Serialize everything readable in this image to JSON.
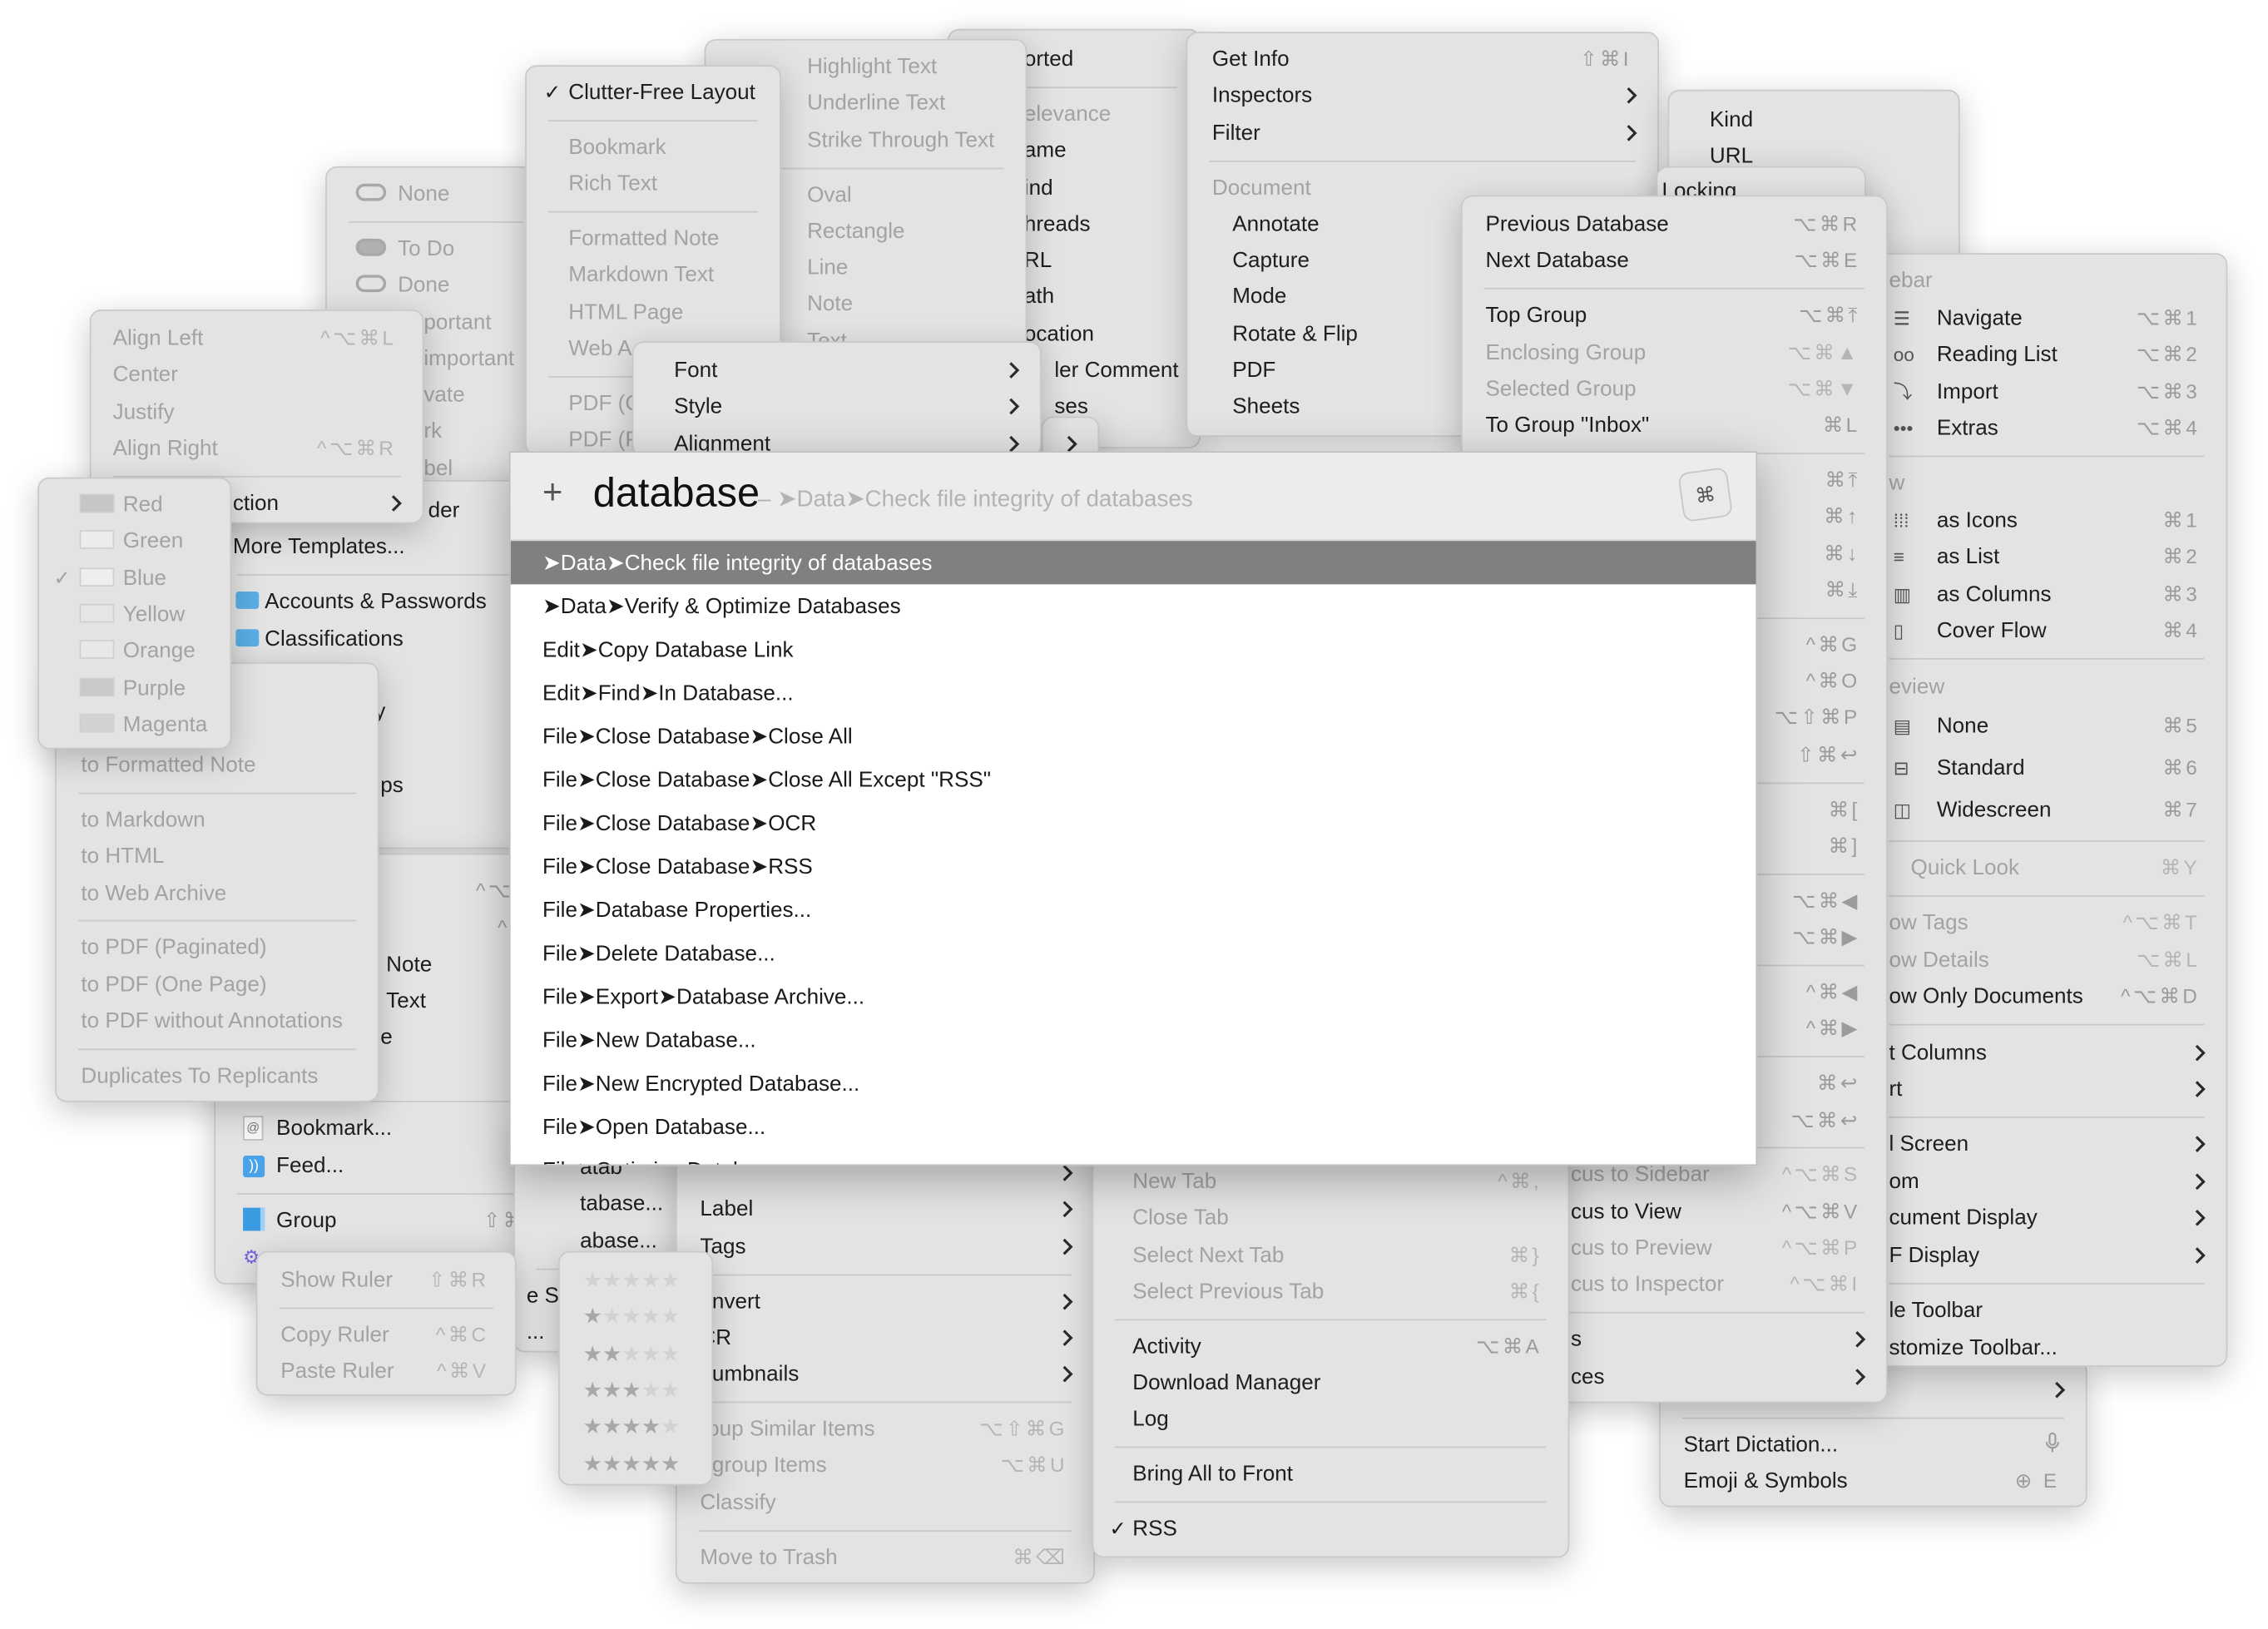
{
  "menus": [
    {
      "id": "label",
      "items": [
        {
          "label": "None",
          "icon": "pill-outline",
          "disabled": true
        },
        {
          "sep": true
        },
        {
          "label": "To Do",
          "icon": "pill-filled",
          "disabled": true
        },
        {
          "label": "Done",
          "icon": "pill-outline",
          "disabled": true
        },
        {
          "label": "portant",
          "disabled": true
        },
        {
          "label": "important",
          "disabled": true
        },
        {
          "label": "vate",
          "disabled": true
        },
        {
          "label": "rk",
          "disabled": true
        },
        {
          "label": "bel",
          "disabled": true
        }
      ]
    },
    {
      "id": "sort",
      "items": [
        {
          "label": "orted"
        },
        {
          "sep": true
        },
        {
          "label": "elevance",
          "disabled": true
        },
        {
          "label": "ame"
        },
        {
          "label": "ind"
        },
        {
          "label": "hreads"
        },
        {
          "label": "RL"
        },
        {
          "label": "ath"
        },
        {
          "label": "ocation"
        },
        {
          "label": "ler Comment"
        },
        {
          "label": "ses"
        }
      ]
    },
    {
      "id": "highlight",
      "items": [
        {
          "label": "Highlight Text",
          "disabled": true
        },
        {
          "label": "Underline Text",
          "disabled": true
        },
        {
          "label": "Strike Through Text",
          "disabled": true
        },
        {
          "sep": true
        },
        {
          "label": "Oval",
          "disabled": true
        },
        {
          "label": "Rectangle",
          "disabled": true
        },
        {
          "label": "Line",
          "disabled": true
        },
        {
          "label": "Note",
          "disabled": true
        },
        {
          "label": "Text",
          "disabled": true
        }
      ]
    },
    {
      "id": "layout",
      "items": [
        {
          "label": "Clutter-Free Layout",
          "checked": true
        },
        {
          "sep": true
        },
        {
          "label": "Bookmark",
          "disabled": true
        },
        {
          "label": "Rich Text",
          "disabled": true
        },
        {
          "sep": true
        },
        {
          "label": "Formatted Note",
          "disabled": true
        },
        {
          "label": "Markdown Text",
          "disabled": true
        },
        {
          "label": "HTML Page",
          "disabled": true
        },
        {
          "label": "Web A",
          "disabled": true
        },
        {
          "sep": true
        },
        {
          "label": "PDF (C",
          "disabled": true
        },
        {
          "label": "PDF (P",
          "disabled": true
        }
      ]
    },
    {
      "id": "templates",
      "items": [
        {
          "label": "der"
        },
        {
          "label": "More Templates..."
        },
        {
          "sep": true
        },
        {
          "label": "Accounts & Passwords",
          "icon": "folder"
        },
        {
          "label": "Classifications",
          "icon": "folder"
        },
        {
          "label": ""
        },
        {
          "label": "y"
        },
        {
          "label": ""
        },
        {
          "label": "ps"
        }
      ]
    },
    {
      "id": "submenu-stub",
      "items": [
        {
          "label": "",
          "arrow": true
        }
      ]
    },
    {
      "id": "format",
      "items": [
        {
          "label": "Font",
          "arrow": true
        },
        {
          "label": "Style",
          "arrow": true
        },
        {
          "label": "Alignment",
          "arrow": true
        }
      ]
    },
    {
      "id": "tools",
      "items": [
        {
          "label": "Get Info",
          "shortcut": "⇧⌘I"
        },
        {
          "label": "Inspectors",
          "arrow": true
        },
        {
          "label": "Filter",
          "arrow": true
        },
        {
          "sep": true
        },
        {
          "label": "Document",
          "disabled": true
        },
        {
          "label": "Annotate"
        },
        {
          "label": "Capture"
        },
        {
          "label": "Mode"
        },
        {
          "label": "Rotate & Flip"
        },
        {
          "label": "PDF"
        },
        {
          "label": "Sheets"
        }
      ]
    },
    {
      "id": "columns",
      "items": [
        {
          "label": "Kind"
        },
        {
          "label": "URL"
        }
      ]
    },
    {
      "id": "locking",
      "items": [
        {
          "label": "Locking"
        }
      ]
    },
    {
      "id": "edit",
      "items": [
        {
          "label": "",
          "arrow": true
        },
        {
          "sep": true
        },
        {
          "label": "Start Dictation...",
          "shortcut": "mic-icon"
        },
        {
          "label": "Emoji & Symbols",
          "shortcut": "⊕ E"
        }
      ]
    },
    {
      "id": "view",
      "items": [
        {
          "label": "ebar",
          "disabled": true
        },
        {
          "label": "Navigate",
          "icon": "list",
          "shortcut": "⌥⌘1"
        },
        {
          "label": "Reading List",
          "icon": "glasses",
          "shortcut": "⌥⌘2"
        },
        {
          "label": "Import",
          "icon": "import",
          "shortcut": "⌥⌘3"
        },
        {
          "label": "Extras",
          "icon": "ellipsis",
          "shortcut": "⌥⌘4"
        },
        {
          "sep": true
        },
        {
          "label": "w",
          "disabled": true
        },
        {
          "label": "as Icons",
          "icon": "grid",
          "shortcut": "⌘1"
        },
        {
          "label": "as List",
          "icon": "lines",
          "shortcut": "⌘2"
        },
        {
          "label": "as Columns",
          "icon": "columns",
          "shortcut": "⌘3"
        },
        {
          "label": "Cover Flow",
          "icon": "cover-flow",
          "shortcut": "⌘4"
        },
        {
          "sep": true
        },
        {
          "label": "eview",
          "disabled": true
        },
        {
          "label": "None",
          "icon": "preview-none",
          "shortcut": "⌘5"
        },
        {
          "label": "Standard",
          "icon": "preview-standard",
          "shortcut": "⌘6"
        },
        {
          "label": "Widescreen",
          "icon": "preview-wide",
          "shortcut": "⌘7"
        },
        {
          "sep": true
        },
        {
          "label": "Quick Look",
          "disabled": true,
          "shortcut": "⌘Y"
        },
        {
          "sep": true
        },
        {
          "label": "ow Tags",
          "disabled": true,
          "shortcut": "^⌥⌘T"
        },
        {
          "label": "ow Details",
          "disabled": true,
          "shortcut": "⌥⌘L"
        },
        {
          "label": "ow Only Documents",
          "shortcut": "^⌥⌘D"
        },
        {
          "sep": true
        },
        {
          "label": "t Columns",
          "arrow": true
        },
        {
          "label": "rt",
          "arrow": true
        },
        {
          "sep": true
        },
        {
          "label": "l Screen",
          "arrow": true
        },
        {
          "label": "om",
          "arrow": true
        },
        {
          "label": "cument Display",
          "arrow": true
        },
        {
          "label": "F Display",
          "arrow": true
        },
        {
          "sep": true
        },
        {
          "label": "le Toolbar"
        },
        {
          "label": "stomize Toolbar..."
        }
      ]
    },
    {
      "id": "go",
      "items": [
        {
          "label": "Previous Database",
          "shortcut": "⌥⌘R"
        },
        {
          "label": "Next Database",
          "shortcut": "⌥⌘E"
        },
        {
          "sep": true
        },
        {
          "label": "Top Group",
          "shortcut": "⌥⌘⤒"
        },
        {
          "label": "Enclosing Group",
          "disabled": true,
          "shortcut": "⌥⌘▲"
        },
        {
          "label": "Selected Group",
          "disabled": true,
          "shortcut": "⌥⌘▼"
        },
        {
          "label": "To Group \"Inbox\"",
          "shortcut": "⌘L"
        },
        {
          "sep": true
        },
        {
          "label": "",
          "shortcut": "⌘⤒"
        },
        {
          "label": "",
          "shortcut": "⌘↑"
        },
        {
          "label": "",
          "shortcut": "⌘↓"
        },
        {
          "label": "",
          "shortcut": "⌘⤓"
        },
        {
          "sep": true
        },
        {
          "label": "",
          "shortcut": "^⌘G"
        },
        {
          "label": "",
          "shortcut": "^⌘O"
        },
        {
          "label": "",
          "shortcut": "⌥⇧⌘P"
        },
        {
          "label": "",
          "shortcut": "⇧⌘↩"
        },
        {
          "sep": true
        },
        {
          "label": "",
          "shortcut": "⌘["
        },
        {
          "label": "",
          "shortcut": "⌘]"
        },
        {
          "sep": true
        },
        {
          "label": "",
          "shortcut": "⌥⌘◀"
        },
        {
          "label": "",
          "shortcut": "⌥⌘▶"
        },
        {
          "sep": true
        },
        {
          "label": "",
          "shortcut": "^⌘◀"
        },
        {
          "label": "",
          "shortcut": "^⌘▶"
        },
        {
          "sep": true
        },
        {
          "label": "",
          "shortcut": "⌘↩"
        },
        {
          "label": "",
          "shortcut": "⌥⌘↩"
        },
        {
          "sep": true
        },
        {
          "label": "cus to Sidebar",
          "disabled": true,
          "shortcut": "^⌥⌘S"
        },
        {
          "label": "cus to View",
          "shortcut": "^⌥⌘V"
        },
        {
          "label": "cus to Preview",
          "disabled": true,
          "shortcut": "^⌥⌘P"
        },
        {
          "label": "cus to Inspector",
          "disabled": true,
          "shortcut": "^⌥⌘I"
        },
        {
          "sep": true
        },
        {
          "label": "s",
          "arrow": true
        },
        {
          "label": "ces",
          "arrow": true
        }
      ]
    },
    {
      "id": "new",
      "items": [
        {
          "label": "",
          "shortcut": "^⌥"
        },
        {
          "label": "",
          "shortcut": "^"
        },
        {
          "label": "Note"
        },
        {
          "label": "Text"
        },
        {
          "label": "e"
        },
        {
          "label": ""
        },
        {
          "sep": true
        },
        {
          "label": "Bookmark...",
          "icon": "bookmark"
        },
        {
          "label": "Feed...",
          "icon": "feed"
        },
        {
          "sep": true
        },
        {
          "label": "Group",
          "icon": "group",
          "shortcut": "⇧⌘N"
        },
        {
          "label": "",
          "icon": "gear"
        }
      ]
    },
    {
      "id": "file",
      "items": [
        {
          "label": "atab"
        },
        {
          "label": "tabase..."
        },
        {
          "label": "abase..."
        },
        {
          "sep": true
        },
        {
          "label": "e Set"
        },
        {
          "label": "..."
        }
      ]
    },
    {
      "id": "data",
      "items": [
        {
          "label": "",
          "arrow": true
        },
        {
          "label": "Label",
          "arrow": true
        },
        {
          "label": "Tags",
          "arrow": true
        },
        {
          "sep": true
        },
        {
          "label": "onvert",
          "arrow": true
        },
        {
          "label": "CR",
          "arrow": true
        },
        {
          "label": "humbnails",
          "arrow": true
        },
        {
          "sep": true
        },
        {
          "label": "roup Similar Items",
          "disabled": true,
          "shortcut": "⌥⇧⌘G"
        },
        {
          "label": "ngroup Items",
          "disabled": true,
          "shortcut": "⌥⌘U"
        },
        {
          "label": "Classify",
          "disabled": true
        },
        {
          "sep": true
        },
        {
          "label": "Move to Trash",
          "disabled": true,
          "shortcut": "⌘⌫"
        }
      ]
    },
    {
      "id": "window",
      "items": [
        {
          "label": "New Tab",
          "disabled": true,
          "shortcut": "^⌘,"
        },
        {
          "label": "Close Tab",
          "disabled": true
        },
        {
          "label": "Select Next Tab",
          "disabled": true,
          "shortcut": "⌘}"
        },
        {
          "label": "Select Previous Tab",
          "disabled": true,
          "shortcut": "⌘{"
        },
        {
          "sep": true
        },
        {
          "label": "Activity",
          "shortcut": "⌥⌘A"
        },
        {
          "label": "Download Manager"
        },
        {
          "label": "Log"
        },
        {
          "sep": true
        },
        {
          "label": "Bring All to Front"
        },
        {
          "sep": true
        },
        {
          "label": "RSS",
          "checked": true
        }
      ]
    },
    {
      "id": "rating",
      "items": [
        {
          "rating": 0
        },
        {
          "rating": 1
        },
        {
          "rating": 2
        },
        {
          "rating": 3
        },
        {
          "rating": 4
        },
        {
          "rating": 5
        }
      ]
    },
    {
      "id": "alignment",
      "items": [
        {
          "label": "Align Left",
          "disabled": true,
          "shortcut": "^⌥⌘L"
        },
        {
          "label": "Center",
          "disabled": true
        },
        {
          "label": "Justify",
          "disabled": true
        },
        {
          "label": "Align Right",
          "disabled": true,
          "shortcut": "^⌥⌘R"
        },
        {
          "sep": true
        },
        {
          "label": "ction",
          "arrow": true
        }
      ]
    },
    {
      "id": "convert",
      "items": [
        {
          "label": ""
        },
        {
          "label": ""
        },
        {
          "label": "to Formatted Note",
          "disabled": true
        },
        {
          "sep": true
        },
        {
          "label": "to Markdown",
          "disabled": true
        },
        {
          "label": "to HTML",
          "disabled": true
        },
        {
          "label": "to Web Archive",
          "disabled": true
        },
        {
          "sep": true
        },
        {
          "label": "to PDF (Paginated)",
          "disabled": true
        },
        {
          "label": "to PDF (One Page)",
          "disabled": true
        },
        {
          "label": "to PDF without Annotations",
          "disabled": true
        },
        {
          "sep": true
        },
        {
          "label": "Duplicates To Replicants",
          "disabled": true
        }
      ]
    },
    {
      "id": "color",
      "items": [
        {
          "label": "Red",
          "icon": "swatch",
          "color": "#c6c6c6",
          "disabled": true
        },
        {
          "label": "Green",
          "icon": "swatch",
          "color": "#ececec",
          "disabled": true
        },
        {
          "label": "Blue",
          "icon": "swatch",
          "color": "#eeeeee",
          "disabled": true,
          "checked": true
        },
        {
          "label": "Yellow",
          "icon": "swatch",
          "color": "#e6e6e6",
          "disabled": true
        },
        {
          "label": "Orange",
          "icon": "swatch",
          "color": "#e8e8e8",
          "disabled": true
        },
        {
          "label": "Purple",
          "icon": "swatch",
          "color": "#c9c9c9",
          "disabled": true
        },
        {
          "label": "Magenta",
          "icon": "swatch",
          "color": "#d2d2d2",
          "disabled": true
        }
      ]
    },
    {
      "id": "ruler",
      "items": [
        {
          "label": "Show Ruler",
          "disabled": true,
          "shortcut": "⇧⌘R"
        },
        {
          "sep": true
        },
        {
          "label": "Copy Ruler",
          "disabled": true,
          "shortcut": "^⌘C"
        },
        {
          "label": "Paste Ruler",
          "disabled": true,
          "shortcut": "^⌘V"
        }
      ]
    }
  ],
  "palette": {
    "plus": "+",
    "query": "database",
    "hint": "– ➤Data➤Check file integrity of databases",
    "app_icon": "⌘",
    "selected_color": "#808080",
    "results": [
      "➤Data➤Check file integrity of databases",
      "➤Data➤Verify & Optimize Databases",
      "Edit➤Copy Database Link",
      "Edit➤Find➤In Database...",
      "File➤Close Database➤Close All",
      "File➤Close Database➤Close All Except \"RSS\"",
      "File➤Close Database➤OCR",
      "File➤Close Database➤RSS",
      "File➤Database Properties...",
      "File➤Delete Database...",
      "File➤Export➤Database Archive...",
      "File➤New Database...",
      "File➤New Encrypted Database...",
      "File➤Open Database...",
      "File➤Optimize Database"
    ]
  }
}
